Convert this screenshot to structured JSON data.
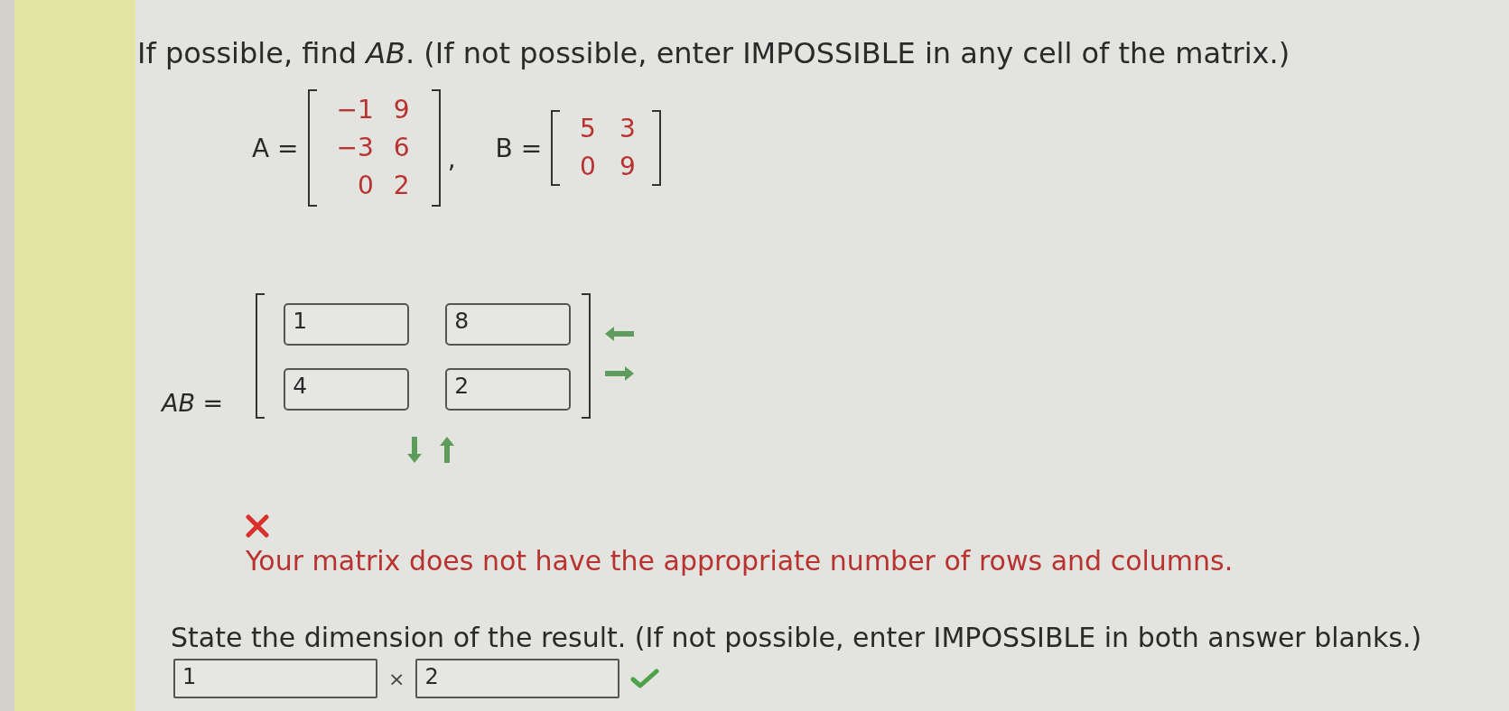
{
  "question": {
    "text": "If possible, find *AB*. (If not possible, enter IMPOSSIBLE in any cell of the matrix.)"
  },
  "given": {
    "matrices": [
      {
        "label": "A =",
        "rows": [
          [
            "−1",
            "9"
          ],
          [
            "−3",
            "6"
          ],
          [
            "0",
            "2"
          ]
        ]
      },
      {
        "label": "B =",
        "rows": [
          [
            "5",
            "3"
          ],
          [
            "0",
            "9"
          ]
        ]
      }
    ],
    "separator": ","
  },
  "answer": {
    "label": "*AB* =",
    "rows": [
      [
        "1",
        "8"
      ],
      [
        "4",
        "2"
      ]
    ]
  },
  "feedback": {
    "correct": false,
    "message": "Your matrix does not have the appropriate number of rows and columns."
  },
  "dimension": {
    "prompt": "State the dimension of the result. (If not possible, enter IMPOSSIBLE in both answer blanks.)",
    "rows_value": "1",
    "times": "×",
    "columns_value": "2",
    "correct": true
  }
}
